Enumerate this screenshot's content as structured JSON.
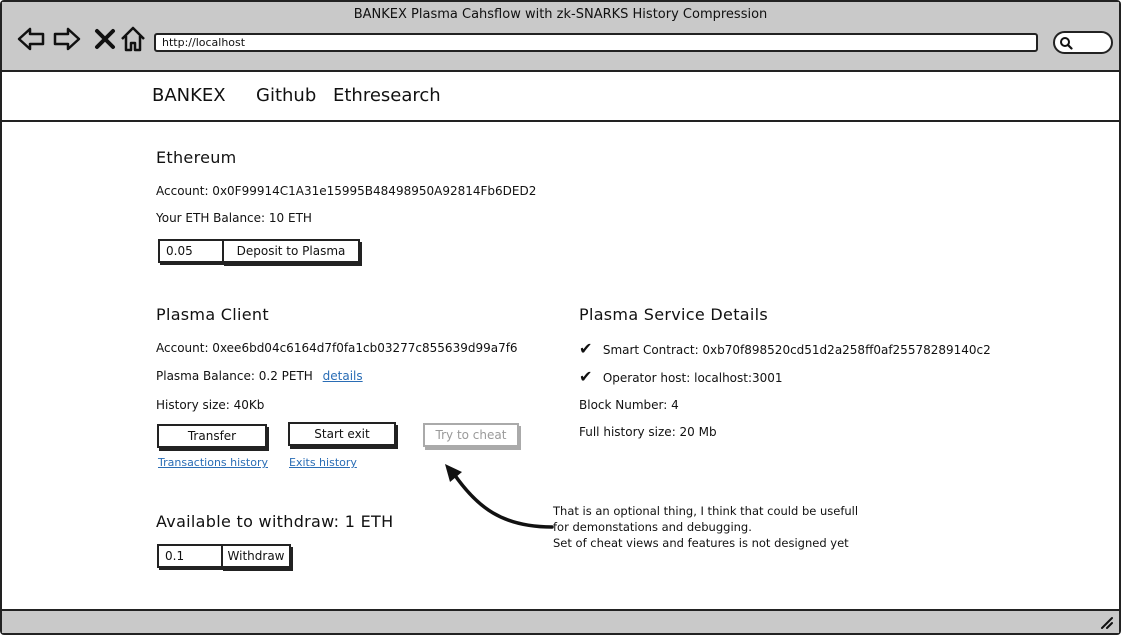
{
  "window": {
    "title": "BANKEX Plasma Cahsflow with zk-SNARKS History Compression",
    "url": "http://localhost"
  },
  "navbar": {
    "items": [
      "BANKEX",
      "Github",
      "Ethresearch"
    ]
  },
  "ethereum": {
    "heading": "Ethereum",
    "account": "Account: 0x0F99914C1A31e15995B48498950A92814Fb6DED2",
    "balance": "Your ETH Balance: 10 ETH",
    "deposit_value": "0.05",
    "deposit_button": "Deposit to Plasma"
  },
  "plasma_client": {
    "heading": "Plasma Client",
    "account": "Account: 0xee6bd04c6164d7f0fa1cb03277c855639d99a7f6",
    "balance": "Plasma Balance: 0.2 PETH",
    "details_link": "details",
    "history_size": "History size: 40Kb",
    "transfer_button": "Transfer",
    "start_exit_button": "Start exit",
    "cheat_button": "Try to cheat",
    "transactions_link": "Transactions history",
    "exits_link": "Exits history"
  },
  "withdraw": {
    "heading": "Available to withdraw: 1 ETH",
    "value": "0.1",
    "button": "Withdraw"
  },
  "service": {
    "heading": "Plasma Service Details",
    "smart_contract": "Smart Contract: 0xb70f898520cd51d2a258ff0af25578289140c2",
    "operator_host": "Operator host: localhost:3001",
    "block_number": "Block Number: 4",
    "full_history": "Full history size: 20 Mb"
  },
  "annotation": {
    "line1": "That is an optional thing, I think that could be usefull",
    "line2": "for demonstations and debugging.",
    "line3": "Set of cheat views and features is not designed yet"
  }
}
